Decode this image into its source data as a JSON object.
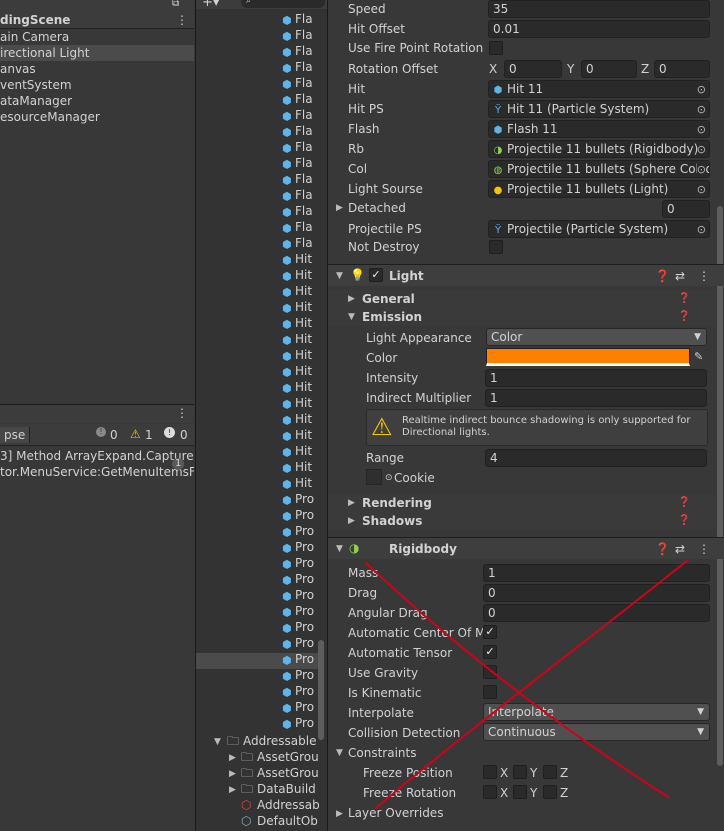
{
  "hierarchy": {
    "scene_name": "dingScene",
    "items": [
      "ain Camera",
      "irectional Light",
      "anvas",
      "ventSystem",
      "ataManager",
      "esourceManager"
    ]
  },
  "console": {
    "collapse_label": "pse",
    "log_count": "0",
    "warn_count": "1",
    "error_count": "0",
    "lines": [
      "3] Method ArrayExpand.CaptureSce",
      "tor.MenuService:GetMenuItemsFro"
    ],
    "badge": "1"
  },
  "project": {
    "search_placeholder": "",
    "items": [
      "Fla",
      "Fla",
      "Fla",
      "Fla",
      "Fla",
      "Fla",
      "Fla",
      "Fla",
      "Fla",
      "Fla",
      "Fla",
      "Fla",
      "Fla",
      "Fla",
      "Fla",
      "Hit",
      "Hit",
      "Hit",
      "Hit",
      "Hit",
      "Hit",
      "Hit",
      "Hit",
      "Hit",
      "Hit",
      "Hit",
      "Hit",
      "Hit",
      "Hit",
      "Hit",
      "Pro",
      "Pro",
      "Pro",
      "Pro",
      "Pro",
      "Pro",
      "Pro",
      "Pro",
      "Pro",
      "Pro",
      "Pro",
      "Pro",
      "Pro",
      "Pro",
      "Pro"
    ],
    "selected_index": 41,
    "folders": [
      {
        "label": "Addressable",
        "level": 0
      },
      {
        "label": "AssetGrou",
        "level": 1
      },
      {
        "label": "AssetGrou",
        "level": 1
      },
      {
        "label": "DataBuild",
        "level": 1
      },
      {
        "label": "Addressab",
        "level": 1
      },
      {
        "label": "DefaultOb",
        "level": 1
      }
    ]
  },
  "inspector": {
    "projectile": {
      "speed_label": "Speed",
      "speed_value": "35",
      "hit_offset_label": "Hit Offset",
      "hit_offset_value": "0.01",
      "fire_rot_label": "Use Fire Point Rotation",
      "rot_offset_label": "Rotation Offset",
      "x_label": "X",
      "x": "0",
      "y_label": "Y",
      "y": "0",
      "z_label": "Z",
      "z": "0",
      "hit_label": "Hit",
      "hit_value": "Hit 11",
      "hitps_label": "Hit PS",
      "hitps_value": "Hit 11 (Particle System)",
      "flash_label": "Flash",
      "flash_value": "Flash 11",
      "rb_label": "Rb",
      "rb_value": "Projectile 11 bullets (Rigidbody)",
      "col_label": "Col",
      "col_value": "Projectile 11 bullets (Sphere Collid",
      "light_label": "Light Sourse",
      "light_value": "Projectile 11 bullets (Light)",
      "detached_label": "Detached",
      "detached_value": "0",
      "projps_label": "Projectile PS",
      "projps_value": "Projectile (Particle System)",
      "notdestroy_label": "Not Destroy"
    },
    "light": {
      "title": "Light",
      "general": "General",
      "emission": "Emission",
      "appearance_label": "Light Appearance",
      "appearance_value": "Color",
      "color_label": "Color",
      "color_hex": "#ff7f00",
      "intensity_label": "Intensity",
      "intensity_value": "1",
      "indirect_label": "Indirect Multiplier",
      "indirect_value": "1",
      "warning": "Realtime indirect bounce shadowing is only supported for Directional lights.",
      "range_label": "Range",
      "range_value": "4",
      "cookie_label": "Cookie",
      "rendering": "Rendering",
      "shadows": "Shadows"
    },
    "rigidbody": {
      "title": "Rigidbody",
      "mass_label": "Mass",
      "mass_value": "1",
      "drag_label": "Drag",
      "drag_value": "0",
      "angdrag_label": "Angular Drag",
      "angdrag_value": "0",
      "autocenter_label": "Automatic Center Of Ma",
      "autotensor_label": "Automatic Tensor",
      "gravity_label": "Use Gravity",
      "kinematic_label": "Is Kinematic",
      "interp_label": "Interpolate",
      "interp_value": "Interpolate",
      "collision_label": "Collision Detection",
      "collision_value": "Continuous",
      "constraints_label": "Constraints",
      "freeze_pos_label": "Freeze Position",
      "freeze_rot_label": "Freeze Rotation",
      "x": "X",
      "y": "Y",
      "z": "Z",
      "layer_overrides": "Layer Overrides"
    },
    "cross_color": "#d0021b"
  }
}
